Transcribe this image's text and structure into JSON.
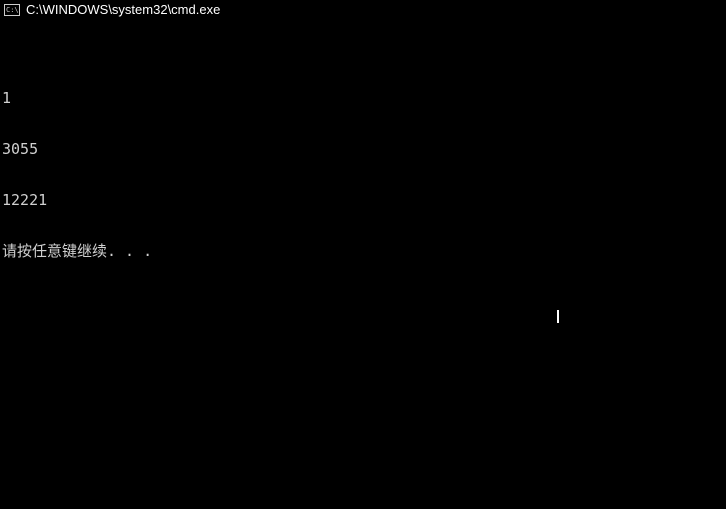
{
  "titlebar": {
    "title": "C:\\WINDOWS\\system32\\cmd.exe"
  },
  "console": {
    "lines": [
      "",
      "1",
      "3055",
      "12221",
      "请按任意键继续. . ."
    ]
  }
}
